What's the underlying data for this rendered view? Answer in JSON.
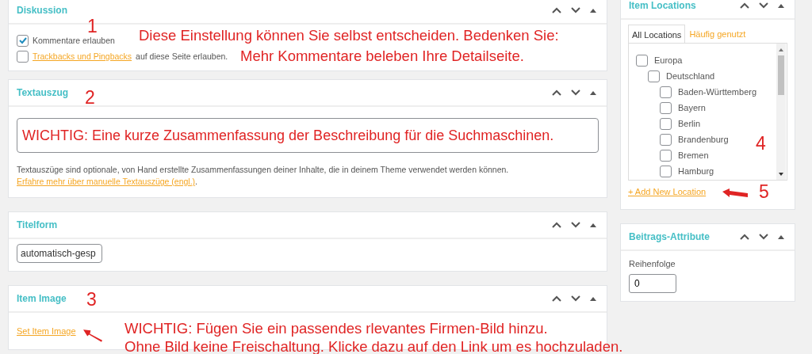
{
  "discussion": {
    "title": "Diskussion",
    "options": [
      {
        "label": "Kommentare erlauben",
        "checked": true
      },
      {
        "link": "Trackbacks und Pingbacks",
        "label": "auf diese Seite erlauben.",
        "checked": false
      }
    ],
    "annotation": {
      "number": "1",
      "lines": [
        "Diese Einstellung können Sie selbst entscheiden. Bedenken Sie:",
        "Mehr Kommentare beleben Ihre Detailseite."
      ]
    }
  },
  "excerpt": {
    "title": "Textauszug",
    "value": "WICHTIG: Eine kurze Zusammenfassung der Beschreibung für die Suchmaschinen.",
    "hint": "Textauszüge sind optionale, von Hand erstellte Zusammenfassungen deiner Inhalte, die in deinem Theme verwendet werden können.",
    "hint_link": "Erfahre mehr über manuelle Textauszüge (engl.)",
    "hint_end": ".",
    "annotation": {
      "number": "2"
    }
  },
  "slug": {
    "title": "Titelform",
    "value": "automatisch-gesp"
  },
  "item_image": {
    "title": "Item Image",
    "link": "Set Item Image",
    "annotation": {
      "number": "3",
      "lines": [
        "WICHTIG: Fügen Sie ein passendes rlevantes Firmen-Bild hinzu.",
        "Ohne Bild keine Freischaltung. Klicke dazu auf den Link um es hochzuladen."
      ]
    }
  },
  "item_locations": {
    "title": "Item Locations",
    "tabs": [
      {
        "label": "All Locations",
        "selected": true
      },
      {
        "label": "Häufig genutzt",
        "selected": false
      }
    ],
    "tree": [
      {
        "label": "Europa",
        "checked": false,
        "children": [
          {
            "label": "Deutschland",
            "checked": false,
            "children": [
              {
                "label": "Baden-Württemberg",
                "checked": false
              },
              {
                "label": "Bayern",
                "checked": false
              },
              {
                "label": "Berlin",
                "checked": false
              },
              {
                "label": "Brandenburg",
                "checked": false
              },
              {
                "label": "Bremen",
                "checked": false
              },
              {
                "label": "Hamburg",
                "checked": false
              }
            ]
          }
        ]
      }
    ],
    "add_link": "+ Add New Location",
    "annotations": [
      {
        "number": "4"
      },
      {
        "number": "5"
      }
    ]
  },
  "post_attributes": {
    "title": "Beitrags-Attribute",
    "order_label": "Reihenfolge",
    "order_value": "0"
  }
}
